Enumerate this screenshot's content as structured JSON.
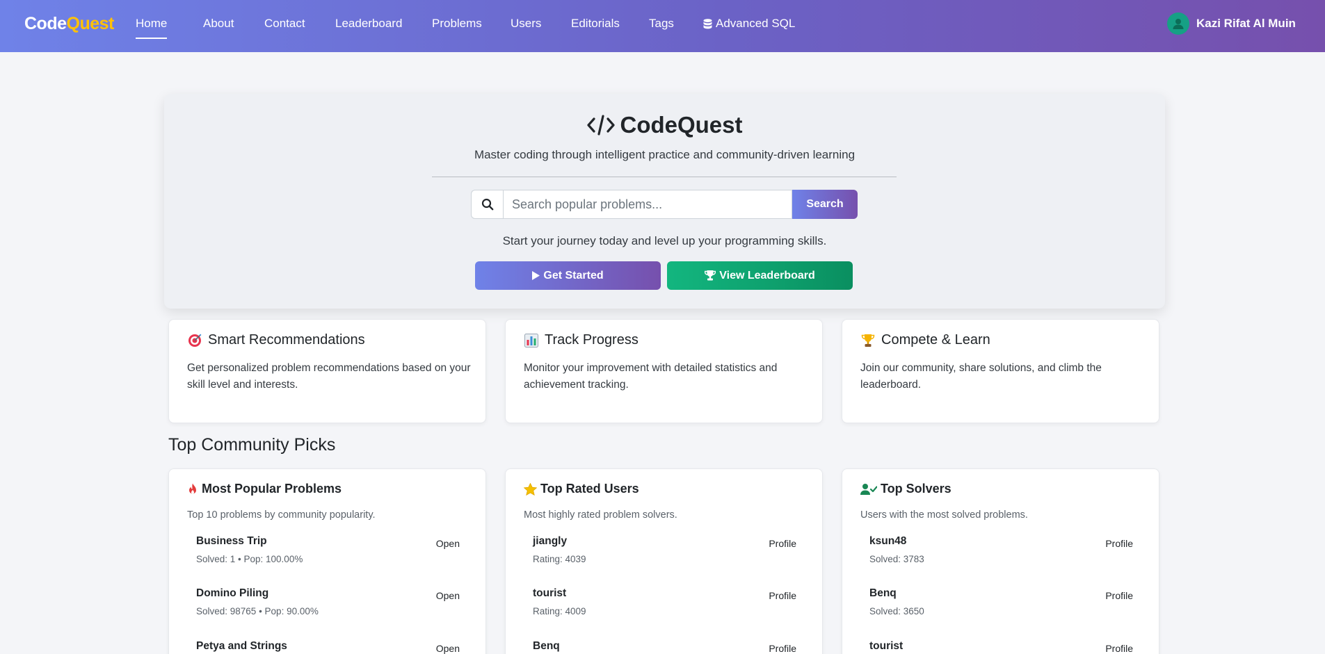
{
  "navbar": {
    "brand_part1": "Code",
    "brand_part2": "Quest",
    "items": [
      "Home",
      "About",
      "Contact",
      "Leaderboard",
      "Problems",
      "Users",
      "Editorials",
      "Tags",
      "Advanced SQL"
    ],
    "active": "Home",
    "user_name": "Kazi Rifat Al Muin",
    "brand_accent_color": "#ffc107"
  },
  "hero": {
    "title": "CodeQuest",
    "subtitle": "Master coding through intelligent practice and community-driven learning",
    "search_placeholder": "Search popular problems...",
    "search_button": "Search",
    "tagline": "Start your journey today and level up your programming skills.",
    "get_started": "Get Started",
    "view_leaderboard": "View Leaderboard"
  },
  "features": [
    {
      "icon": "target-icon",
      "title": "Smart Recommendations",
      "desc": "Get personalized problem recommendations based on your skill level and interests."
    },
    {
      "icon": "bar-chart-icon",
      "title": "Track Progress",
      "desc": "Monitor your improvement with detailed statistics and achievement tracking."
    },
    {
      "icon": "trophy-icon",
      "title": "Compete & Learn",
      "desc": "Join our community, share solutions, and climb the leaderboard."
    }
  ],
  "section_title": "Top Community Picks",
  "popular": {
    "title": "Most Popular Problems",
    "subtitle": "Top 10 problems by community popularity.",
    "items": [
      {
        "name": "Business Trip",
        "meta": "Solved: 1 • Pop: 100.00%",
        "link": "Open"
      },
      {
        "name": "Domino Piling",
        "meta": "Solved: 98765 • Pop: 90.00%",
        "link": "Open"
      },
      {
        "name": "Petya and Strings",
        "meta": "",
        "link": "Open"
      }
    ]
  },
  "rated": {
    "title": "Top Rated Users",
    "subtitle": "Most highly rated problem solvers.",
    "items": [
      {
        "name": "jiangly",
        "meta": "Rating: 4039",
        "link": "Profile"
      },
      {
        "name": "tourist",
        "meta": "Rating: 4009",
        "link": "Profile"
      },
      {
        "name": "Benq",
        "meta": "",
        "link": "Profile"
      }
    ]
  },
  "solvers": {
    "title": "Top Solvers",
    "subtitle": "Users with the most solved problems.",
    "items": [
      {
        "name": "ksun48",
        "meta": "Solved: 3783",
        "link": "Profile"
      },
      {
        "name": "Benq",
        "meta": "Solved: 3650",
        "link": "Profile"
      },
      {
        "name": "tourist",
        "meta": "",
        "link": "Profile"
      }
    ]
  }
}
